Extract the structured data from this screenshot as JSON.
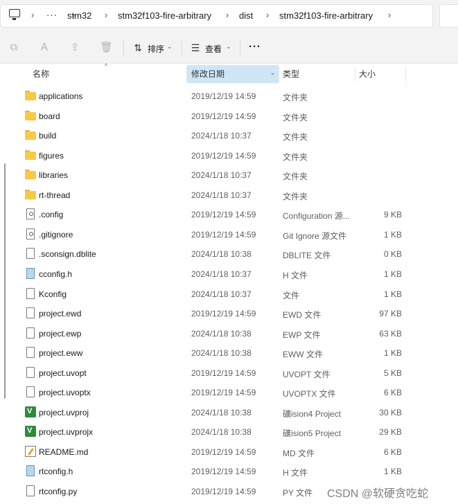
{
  "breadcrumb": [
    "stm32",
    "stm32f103-fire-arbitrary",
    "dist",
    "stm32f103-fire-arbitrary"
  ],
  "breadcrumb_more": "···",
  "toolbar": {
    "sort_label": "排序",
    "view_label": "查看",
    "more_label": "···"
  },
  "columns": {
    "name": "名称",
    "modified": "修改日期",
    "type": "类型",
    "size": "大小"
  },
  "files": [
    {
      "name": "applications",
      "date": "2019/12/19 14:59",
      "type": "文件夹",
      "size": "",
      "icon": "folder-icon"
    },
    {
      "name": "board",
      "date": "2019/12/19 14:59",
      "type": "文件夹",
      "size": "",
      "icon": "folder-icon"
    },
    {
      "name": "build",
      "date": "2024/1/18 10:37",
      "type": "文件夹",
      "size": "",
      "icon": "folder-icon"
    },
    {
      "name": "figures",
      "date": "2019/12/19 14:59",
      "type": "文件夹",
      "size": "",
      "icon": "folder-icon"
    },
    {
      "name": "libraries",
      "date": "2024/1/18 10:37",
      "type": "文件夹",
      "size": "",
      "icon": "folder-icon"
    },
    {
      "name": "rt-thread",
      "date": "2024/1/18 10:37",
      "type": "文件夹",
      "size": "",
      "icon": "folder-icon"
    },
    {
      "name": ".config",
      "date": "2019/12/19 14:59",
      "type": "Configuration 源...",
      "size": "9 KB",
      "icon": "config-file-icon"
    },
    {
      "name": ".gitignore",
      "date": "2019/12/19 14:59",
      "type": "Git Ignore 源文件",
      "size": "1 KB",
      "icon": "config-file-icon"
    },
    {
      "name": ".sconsign.dblite",
      "date": "2024/1/18 10:38",
      "type": "DBLITE 文件",
      "size": "0 KB",
      "icon": "file-icon"
    },
    {
      "name": "cconfig.h",
      "date": "2024/1/18 10:37",
      "type": "H 文件",
      "size": "1 KB",
      "icon": "header-file-icon"
    },
    {
      "name": "Kconfig",
      "date": "2024/1/18 10:37",
      "type": "文件",
      "size": "1 KB",
      "icon": "file-icon"
    },
    {
      "name": "project.ewd",
      "date": "2019/12/19 14:59",
      "type": "EWD 文件",
      "size": "97 KB",
      "icon": "file-icon"
    },
    {
      "name": "project.ewp",
      "date": "2024/1/18 10:38",
      "type": "EWP 文件",
      "size": "63 KB",
      "icon": "file-icon"
    },
    {
      "name": "project.eww",
      "date": "2024/1/18 10:38",
      "type": "EWW 文件",
      "size": "1 KB",
      "icon": "file-icon"
    },
    {
      "name": "project.uvopt",
      "date": "2019/12/19 14:59",
      "type": "UVOPT 文件",
      "size": "5 KB",
      "icon": "file-icon"
    },
    {
      "name": "project.uvoptx",
      "date": "2019/12/19 14:59",
      "type": "UVOPTX 文件",
      "size": "6 KB",
      "icon": "file-icon"
    },
    {
      "name": "project.uvproj",
      "date": "2024/1/18 10:38",
      "type": "礦ision4 Project",
      "size": "30 KB",
      "icon": "keil-project-icon"
    },
    {
      "name": "project.uvprojx",
      "date": "2024/1/18 10:38",
      "type": "礦ision5 Project",
      "size": "29 KB",
      "icon": "keil-project-icon"
    },
    {
      "name": "README.md",
      "date": "2019/12/19 14:59",
      "type": "MD 文件",
      "size": "6 KB",
      "icon": "markdown-file-icon"
    },
    {
      "name": "rtconfig.h",
      "date": "2019/12/19 14:59",
      "type": "H 文件",
      "size": "1 KB",
      "icon": "header-file-icon"
    },
    {
      "name": "rtconfig.py",
      "date": "2019/12/19 14:59",
      "type": "PY 文件",
      "size": "",
      "icon": "file-icon"
    }
  ],
  "watermark": "CSDN @软硬贪吃蛇"
}
